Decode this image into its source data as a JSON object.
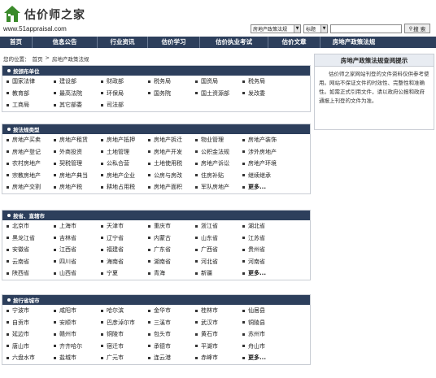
{
  "header": {
    "logo_name": "估价师之家",
    "logo_url": "www.51appraisal.com",
    "search_select1": "房地产政策法规",
    "search_select2": "标题",
    "search_button": "搜 索"
  },
  "nav": [
    "首页",
    "信息公告",
    "行业资讯",
    "估价学习",
    "估价执业考试",
    "估价文章",
    "房地产政策法规"
  ],
  "breadcrumb": {
    "prefix": "您的位置：",
    "home": "首页",
    "sep": ">",
    "current": "房地产政策法规"
  },
  "sections": [
    {
      "title": "按颁布单位",
      "items": [
        "国家法律",
        "建设部",
        "财政部",
        "税务局",
        "国资局",
        "税务局",
        "教育部",
        "最高法院",
        "环保局",
        "国务院",
        "国土资源部",
        "发改委",
        "工商局",
        "其它部委",
        "司法部"
      ]
    },
    {
      "title": "按法规类型",
      "items": [
        "房地产买卖",
        "房地产租赁",
        "房地产抵押",
        "房地产拆迁",
        "物业管理",
        "房地产装饰",
        "房地产登记",
        "外商投资",
        "土地管理",
        "房地产开发",
        "公积金法规",
        "涉外房地产",
        "农村房地产",
        "契税管理",
        "公私合营",
        "土地使用税",
        "房地产诉讼",
        "房地产环境",
        "宗教房地产",
        "房地产典当",
        "房地产企业",
        "公房与房改",
        "住房补贴",
        "继续继承",
        "房地产交割",
        "房地产税",
        "耕地占用税",
        "房地产面积",
        "军队房地产",
        "更多..."
      ]
    },
    {
      "title": "按省、直辖市",
      "items": [
        "北京市",
        "上海市",
        "天津市",
        "重庆市",
        "浙江省",
        "湖北省",
        "黑龙江省",
        "吉林省",
        "辽宁省",
        "内蒙古",
        "山东省",
        "江苏省",
        "安徽省",
        "江西省",
        "福建省",
        "广东省",
        "广西省",
        "贵州省",
        "云南省",
        "四川省",
        "海南省",
        "湖南省",
        "河北省",
        "河南省",
        "陕西省",
        "山西省",
        "宁夏",
        "青海",
        "新疆",
        "更多..."
      ]
    },
    {
      "title": "按行省城市",
      "items": [
        "宁波市",
        "咸阳市",
        "哈尔滨",
        "金华市",
        "桂林市",
        "仙居县",
        "自贡市",
        "安顺市",
        "巴彦淖尔市",
        "三溪市",
        "武汉市",
        "铜陵县",
        "延边市",
        "赣州市",
        "铜陵市",
        "包头市",
        "黄石市",
        "苏州市",
        "唐山市",
        "齐齐哈尔",
        "宿迁市",
        "承德市",
        "平湖市",
        "舟山市",
        "六盘水市",
        "盐城市",
        "广元市",
        "连云港",
        "赤峰市",
        "更多..."
      ]
    }
  ],
  "side": {
    "title": "房地产政策法规查阅提示",
    "body": "估价师之家网站刊登的文件资料仅供参考使用。网站不保证文件的时效性、完整性和准确性。如需正式引用文件，请以政府公报和政府通报上刊登的文件为准。"
  },
  "colors": {
    "nav_bg": "#2d3f5c",
    "logo_green": "#3a8a2a"
  }
}
